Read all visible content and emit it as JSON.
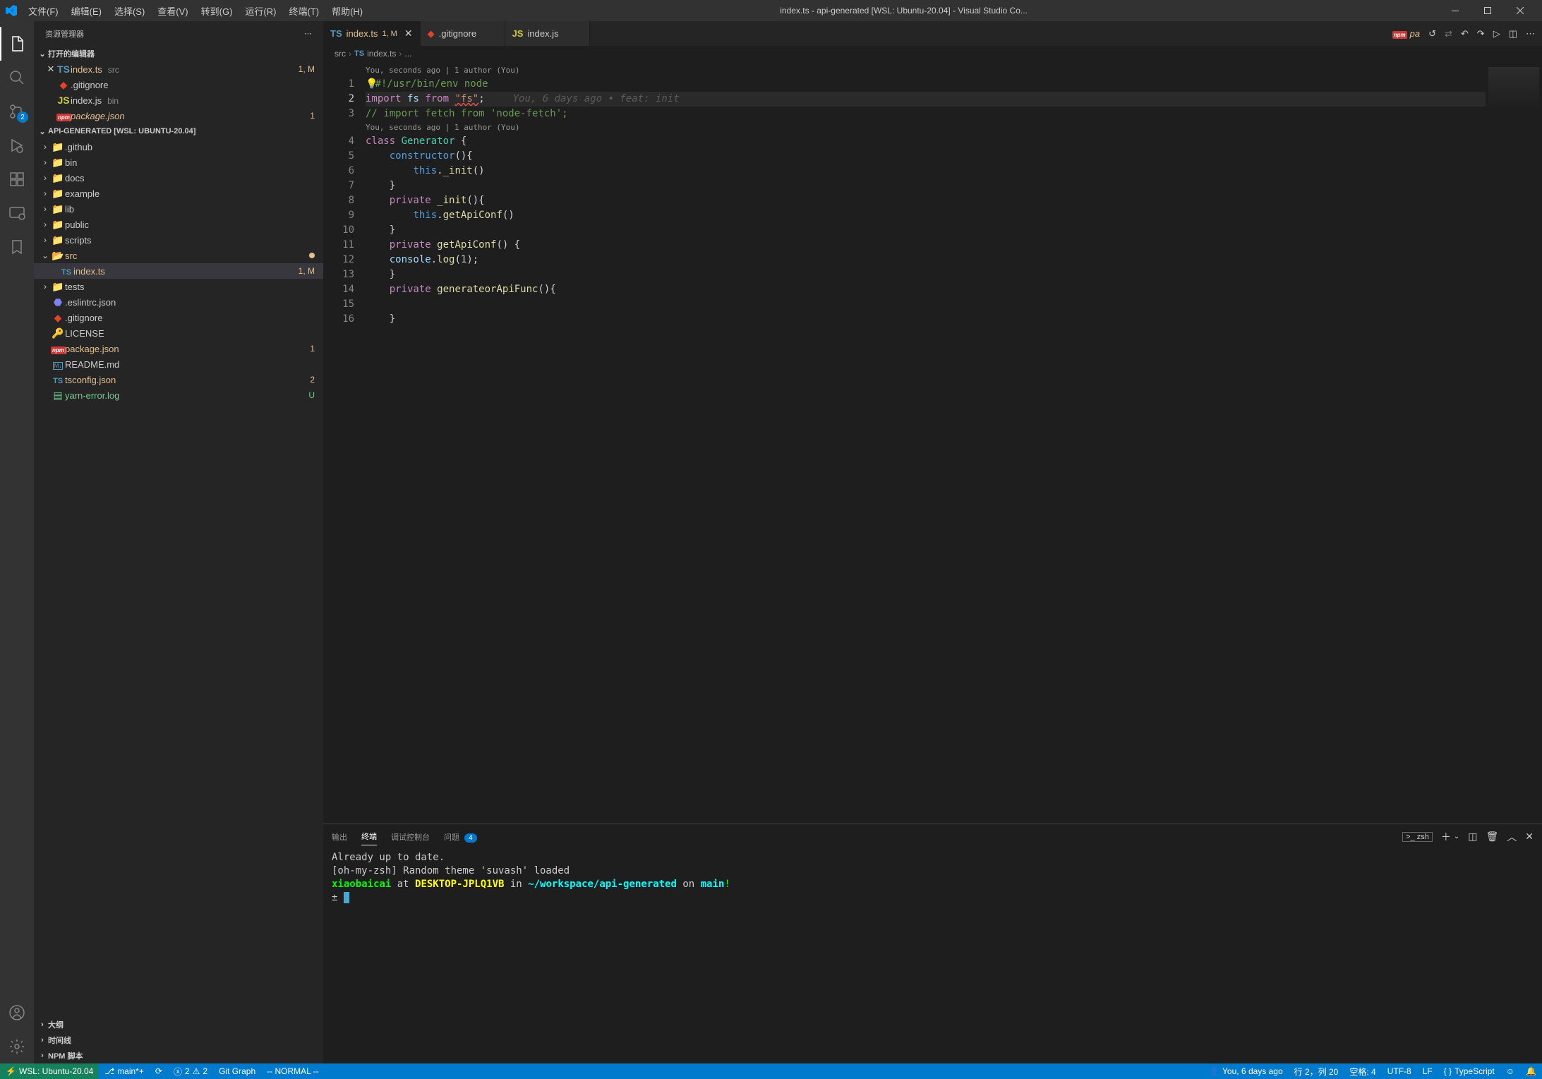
{
  "titlebar": {
    "title": "index.ts - api-generated [WSL: Ubuntu-20.04] - Visual Studio Co...",
    "menu": [
      "文件(F)",
      "编辑(E)",
      "选择(S)",
      "查看(V)",
      "转到(G)",
      "运行(R)",
      "终端(T)",
      "帮助(H)"
    ]
  },
  "activitybar": {
    "scm_badge": "2"
  },
  "sidebar": {
    "title": "资源管理器",
    "open_editors_label": "打开的编辑器",
    "open_editors": [
      {
        "name": "index.ts",
        "dir": "src",
        "badge": "1, M",
        "icon": "ts",
        "close": true,
        "modified": true
      },
      {
        "name": ".gitignore",
        "dir": "",
        "badge": "",
        "icon": "git",
        "close": false
      },
      {
        "name": "index.js",
        "dir": "bin",
        "badge": "",
        "icon": "js",
        "close": false
      },
      {
        "name": "package.json",
        "dir": "",
        "badge": "1",
        "icon": "npm",
        "close": false,
        "modified": true,
        "italic": true
      }
    ],
    "workspace_label": "API-GENERATED [WSL: UBUNTU-20.04]",
    "tree": [
      {
        "name": ".github",
        "type": "folder",
        "indent": 1
      },
      {
        "name": "bin",
        "type": "folder",
        "indent": 1
      },
      {
        "name": "docs",
        "type": "folder",
        "indent": 1
      },
      {
        "name": "example",
        "type": "folder",
        "indent": 1
      },
      {
        "name": "lib",
        "type": "folder",
        "indent": 1
      },
      {
        "name": "public",
        "type": "folder",
        "indent": 1
      },
      {
        "name": "scripts",
        "type": "folder",
        "indent": 1
      },
      {
        "name": "src",
        "type": "folder",
        "indent": 1,
        "open": true,
        "modified": true,
        "dot": true
      },
      {
        "name": "index.ts",
        "type": "file",
        "indent": 2,
        "icon": "ts",
        "badge": "1, M",
        "modified": true,
        "active": true
      },
      {
        "name": "tests",
        "type": "folder",
        "indent": 1
      },
      {
        "name": ".eslintrc.json",
        "type": "file",
        "indent": 1,
        "icon": "eslint"
      },
      {
        "name": ".gitignore",
        "type": "file",
        "indent": 1,
        "icon": "git"
      },
      {
        "name": "LICENSE",
        "type": "file",
        "indent": 1,
        "icon": "license"
      },
      {
        "name": "package.json",
        "type": "file",
        "indent": 1,
        "icon": "npm",
        "badge": "1",
        "modified": true
      },
      {
        "name": "README.md",
        "type": "file",
        "indent": 1,
        "icon": "md"
      },
      {
        "name": "tsconfig.json",
        "type": "file",
        "indent": 1,
        "icon": "tsconfig",
        "badge": "2",
        "modified": true
      },
      {
        "name": "yarn-error.log",
        "type": "file",
        "indent": 1,
        "icon": "log",
        "badge": "U",
        "untracked": true
      }
    ],
    "outline_label": "大纲",
    "timeline_label": "时间线",
    "npm_label": "NPM 脚本"
  },
  "tabs": [
    {
      "name": "index.ts",
      "icon": "ts",
      "badge": "1, M",
      "active": true,
      "close": true
    },
    {
      "name": ".gitignore",
      "icon": "git",
      "active": false
    },
    {
      "name": "index.js",
      "icon": "js",
      "active": false
    },
    {
      "name": "pa",
      "icon": "npm",
      "active": false,
      "italic": true
    }
  ],
  "breadcrumb": {
    "parts": [
      "src",
      "index.ts",
      "..."
    ]
  },
  "editor": {
    "codelens1": "You, seconds ago | 1 author (You)",
    "codelens2": "You, seconds ago | 1 author (You)",
    "blame": "You, 6 days ago • feat: init",
    "lines": {
      "l1": "#!/usr/bin/env node",
      "l3": "// import fetch from 'node-fetch';"
    }
  },
  "panel": {
    "tabs": [
      "输出",
      "终端",
      "调试控制台",
      "问题"
    ],
    "problems_count": "4",
    "shell": "zsh",
    "terminal": {
      "l1": "Already up to date.",
      "l2": "[oh-my-zsh] Random theme 'suvash' loaded",
      "user": "xiaobaicai",
      "at": " at ",
      "host": "DESKTOP-JPLQ1VB",
      "in": " in ",
      "path": "~/workspace/api-generated",
      "on": " on ",
      "branch": "main",
      "dirty": "!",
      "prompt": "± "
    }
  },
  "statusbar": {
    "remote": "WSL: Ubuntu-20.04",
    "branch": "main*+",
    "sync": "",
    "errors": "2",
    "warnings": "2",
    "gitgraph": "Git Graph",
    "vim": "-- NORMAL --",
    "blame": "You, 6 days ago",
    "position": "行 2，列 20",
    "spaces": "空格: 4",
    "encoding": "UTF-8",
    "eol": "LF",
    "lang": "TypeScript"
  }
}
